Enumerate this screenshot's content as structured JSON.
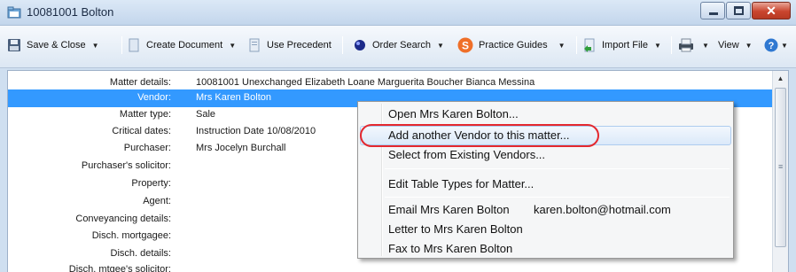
{
  "window": {
    "title": "10081001 Bolton"
  },
  "toolbar": {
    "save_close": "Save & Close",
    "create_document": "Create Document",
    "use_precedent": "Use Precedent",
    "order_search": "Order Search",
    "practice_guides": "Practice Guides",
    "import_file": "Import File",
    "view": "View"
  },
  "details": [
    {
      "label": "Matter details:",
      "value": "10081001  Unexchanged Elizabeth Loane Marguerita Boucher Bianca Messina"
    },
    {
      "label": "Vendor:",
      "value": "Mrs Karen Bolton",
      "selected": true
    },
    {
      "label": "Matter type:",
      "value": "Sale"
    },
    {
      "label": "Critical dates:",
      "value": "Instruction Date 10/08/2010"
    },
    {
      "label": "Purchaser:",
      "value": "Mrs Jocelyn Burchall"
    },
    {
      "label": "Purchaser's solicitor:",
      "value": ""
    },
    {
      "label": "Property:",
      "value": ""
    },
    {
      "label": "Agent:",
      "value": ""
    },
    {
      "label": "Conveyancing details:",
      "value": ""
    },
    {
      "label": "Disch. mortgagee:",
      "value": ""
    },
    {
      "label": "Disch. details:",
      "value": ""
    },
    {
      "label": "Disch. mtgee's solicitor:",
      "value": ""
    }
  ],
  "context_menu": {
    "open": "Open Mrs Karen Bolton...",
    "add_vendor": "Add another Vendor to this matter...",
    "select_existing": "Select from Existing Vendors...",
    "edit_table_types": "Edit Table Types for Matter...",
    "email": "Email Mrs Karen Bolton",
    "email_address": "karen.bolton@hotmail.com",
    "letter": "Letter to Mrs Karen Bolton",
    "fax": "Fax to Mrs Karen Bolton"
  },
  "colors": {
    "selection": "#3399ff",
    "highlight_ring": "#e4282e",
    "title_bar": "#c3d6ec"
  }
}
